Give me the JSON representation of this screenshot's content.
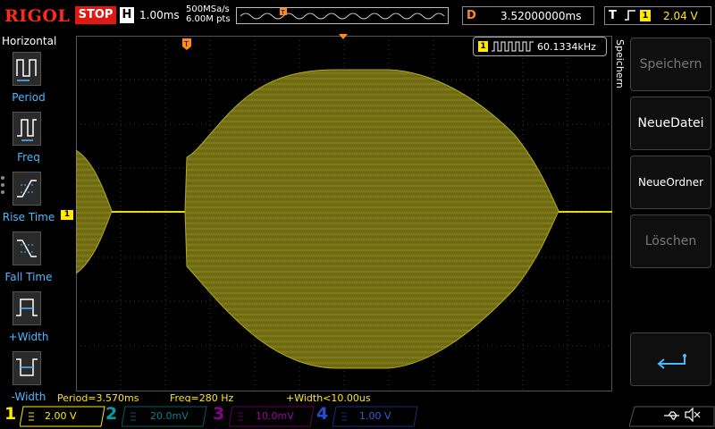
{
  "topbar": {
    "brand": "RIGOL",
    "run_state": "STOP",
    "h_label": "H",
    "timebase": "1.00ms",
    "sample_rate": "500MSa/s",
    "memory_depth": "6.00M pts",
    "delay_label": "D",
    "delay_value": "3.52000000ms",
    "trigger_label": "T",
    "trigger_channel": "1",
    "trigger_level": "2.04 V"
  },
  "left_menu": {
    "title": "Horizontal",
    "items": [
      {
        "label": "Period",
        "icon": "period-icon"
      },
      {
        "label": "Freq",
        "icon": "freq-icon"
      },
      {
        "label": "Rise Time",
        "icon": "rise-time-icon"
      },
      {
        "label": "Fall Time",
        "icon": "fall-time-icon"
      },
      {
        "label": "+Width",
        "icon": "pos-width-icon"
      },
      {
        "label": "-Width",
        "icon": "neg-width-icon"
      }
    ]
  },
  "screen": {
    "ch1_marker": "1",
    "frequency_counter_channel": "1",
    "frequency_counter": "60.1334kHz"
  },
  "measurements": {
    "period": "Period=3.570ms",
    "freq": "Freq=280 Hz",
    "width": "+Width<10.00us"
  },
  "right_menu": {
    "title": "Speichern",
    "buttons": [
      {
        "label": "Speichern",
        "enabled": false
      },
      {
        "label": "NeueDatei",
        "enabled": true
      },
      {
        "label": "NeueOrdner",
        "enabled": true
      },
      {
        "label": "Löschen",
        "enabled": false
      },
      {
        "label": "",
        "icon": "return-icon",
        "enabled": true
      }
    ]
  },
  "channels": [
    {
      "num": "1",
      "scale": "2.00 V",
      "color": "#ffea00",
      "active": true
    },
    {
      "num": "2",
      "scale": "20.0mV",
      "color": "#00a0a8",
      "active": false
    },
    {
      "num": "3",
      "scale": "10.0mV",
      "color": "#c000c0",
      "active": false
    },
    {
      "num": "4",
      "scale": "1.00 V",
      "color": "#2060ff",
      "active": false
    }
  ],
  "colors": {
    "trace": "#c8c000",
    "accent": "#ff8c1a",
    "brand": "#ff2a1a"
  }
}
